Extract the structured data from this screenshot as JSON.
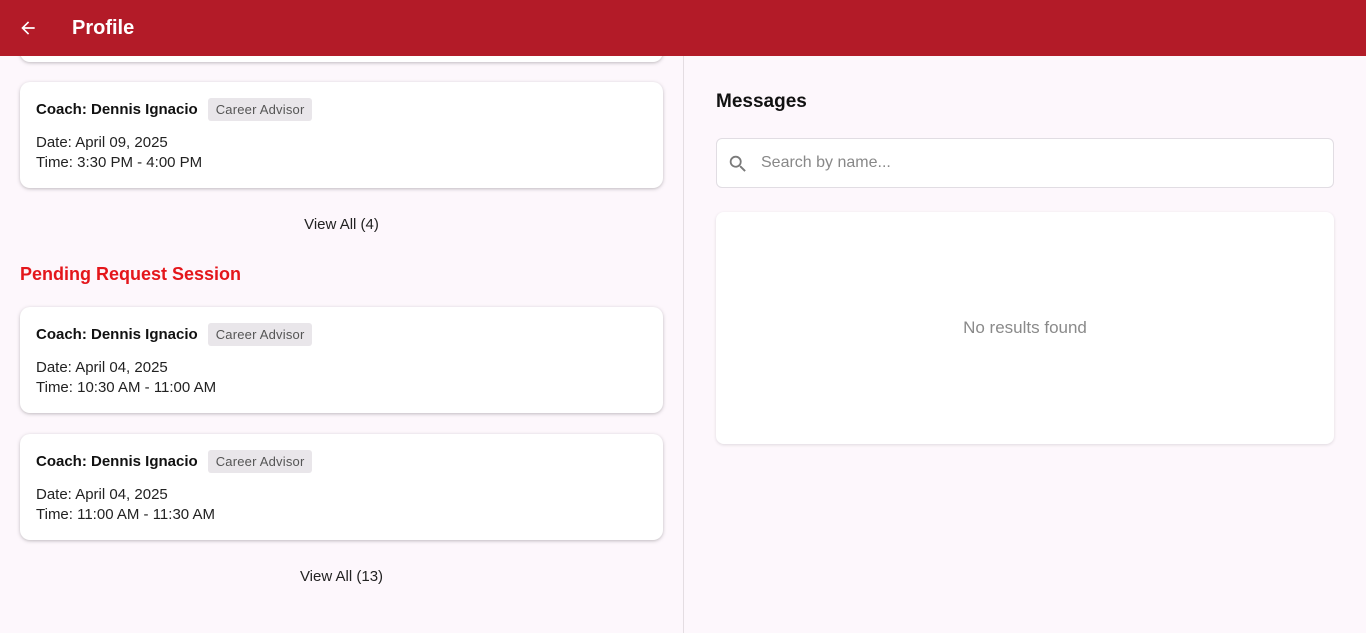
{
  "appbar": {
    "title": "Profile",
    "back_icon": "arrow-left-icon"
  },
  "upcoming": {
    "cards": [
      {
        "coach": "Coach: Dennis Ignacio",
        "role": "Career Advisor",
        "date": "Date: April 09, 2025",
        "time": "Time: 3:30 PM - 4:00 PM"
      }
    ],
    "view_all": "View All (4)"
  },
  "pending": {
    "title": "Pending Request Session",
    "cards": [
      {
        "coach": "Coach: Dennis Ignacio",
        "role": "Career Advisor",
        "date": "Date: April 04, 2025",
        "time": "Time: 10:30 AM - 11:00 AM"
      },
      {
        "coach": "Coach: Dennis Ignacio",
        "role": "Career Advisor",
        "date": "Date: April 04, 2025",
        "time": "Time: 11:00 AM - 11:30 AM"
      }
    ],
    "view_all": "View All (13)"
  },
  "messages": {
    "title": "Messages",
    "search_placeholder": "Search by name...",
    "search_value": "",
    "empty_text": "No results found"
  },
  "colors": {
    "appbar": "#b31b28",
    "section_title": "#e4161b",
    "background": "#fdf7fc"
  }
}
